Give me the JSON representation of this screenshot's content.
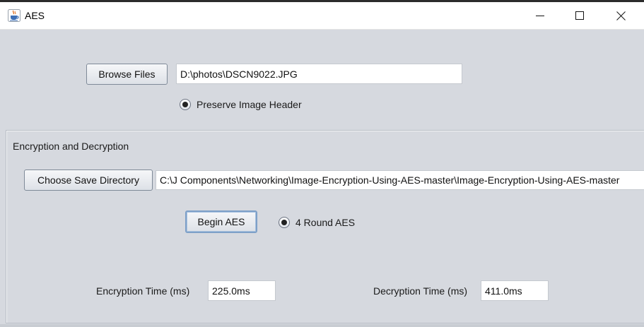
{
  "window": {
    "title": "AES",
    "icon": "java-cup-icon",
    "controls": {
      "minimize": "minimize-icon",
      "maximize": "maximize-icon",
      "close": "close-icon"
    }
  },
  "file_section": {
    "browse_label": "Browse Files",
    "file_path": "D:\\photos\\DSCN9022.JPG",
    "preserve_header_label": "Preserve Image Header",
    "preserve_header_selected": true
  },
  "encryption_panel": {
    "title": "Encryption and Decryption",
    "choose_dir_label": "Choose Save Directory",
    "save_dir": "C:\\J Components\\Networking\\Image-Encryption-Using-AES-master\\Image-Encryption-Using-AES-master",
    "begin_label": "Begin AES",
    "round_label": "4 Round AES",
    "round_selected": true,
    "enc_time_label": "Encryption Time (ms)",
    "enc_time_value": "225.0ms",
    "dec_time_label": "Decryption Time (ms)",
    "dec_time_value": "411.0ms"
  }
}
